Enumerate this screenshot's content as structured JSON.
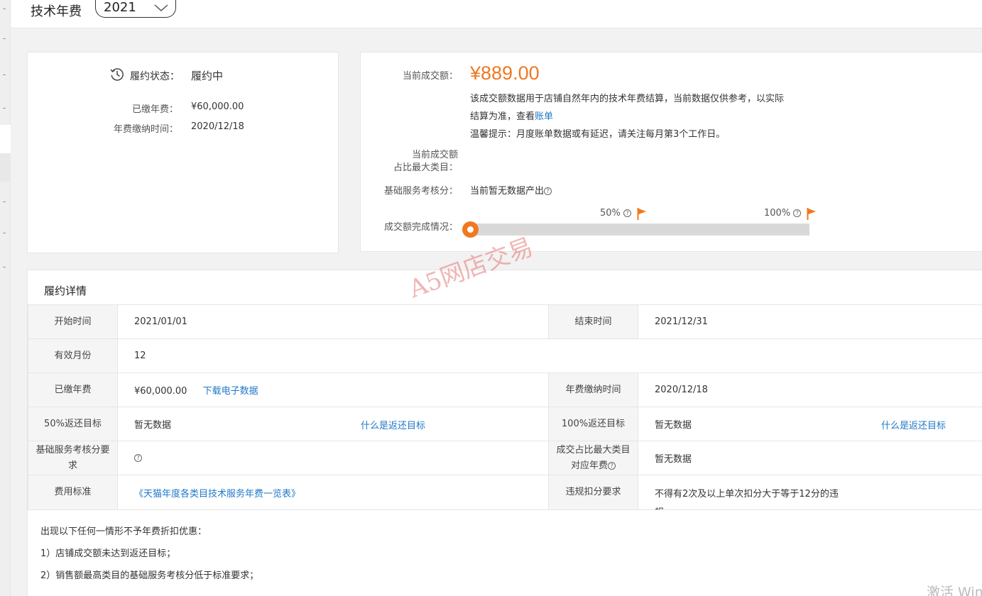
{
  "header": {
    "title": "技术年费",
    "year": "2021"
  },
  "status_card": {
    "status_label": "履约状态：",
    "status_value": "履约中",
    "paid_label": "已缴年费：",
    "paid_value": "¥60,000.00",
    "paid_time_label": "年费缴纳时间：",
    "paid_time_value": "2020/12/18"
  },
  "deal_card": {
    "current_label": "当前成交额：",
    "current_value": "¥889.00",
    "desc_line1": "该成交额数据用于店铺自然年内的技术年费结算，当前数据仅供参考，以实际",
    "desc_line2_prefix": "结算为准，查看",
    "bill_link": "账单",
    "tip": "温馨提示：月度账单数据或有延迟，请关注每月第3个工作日。",
    "top_category_label_1": "当前成交额",
    "top_category_label_2": "占比最大类目：",
    "service_score_label": "基础服务考核分：",
    "service_score_value": "当前暂无数据产出",
    "completion_label": "成交额完成情况：",
    "progress_fraction": 0.0,
    "marker_50": "50%",
    "marker_100": "100%"
  },
  "detail": {
    "title": "履约详情",
    "rows": {
      "start_label": "开始时间",
      "start_value": "2021/01/01",
      "end_label": "结束时间",
      "end_value": "2021/12/31",
      "months_label": "有效月份",
      "months_value": "12",
      "paid_label": "已缴年费",
      "paid_value": "¥60,000.00",
      "download_link": "下载电子数据",
      "paid_time_label": "年费缴纳时间",
      "paid_time_value": "2020/12/18",
      "target50_label": "50%返还目标",
      "target50_value": "暂无数据",
      "target50_link": "什么是返还目标",
      "target100_label": "100%返还目标",
      "target100_value": "暂无数据",
      "target100_link": "什么是返还目标",
      "score_req_label_1": "基础服务考核分要",
      "score_req_label_2": "求",
      "max_cat_label_1": "成交占比最大类目",
      "max_cat_label_2": "对应年费",
      "max_cat_value": "暂无数据",
      "fee_std_label": "费用标准",
      "fee_std_link": "《天猫年度各类目技术服务年费一览表》",
      "violation_label": "违规扣分要求",
      "violation_value_1": "不得有2次及以上单次扣分大于等于12分的违",
      "violation_value_2": "规"
    },
    "notes": {
      "intro": "出现以下任何一情形不予年费折扣优惠：",
      "item1": "1）店铺成交额未达到返还目标；",
      "item2": "2）销售额最高类目的基础服务考核分低于标准要求；"
    }
  },
  "watermark": "A5网店交易",
  "os_overlay": "激活 Win"
}
